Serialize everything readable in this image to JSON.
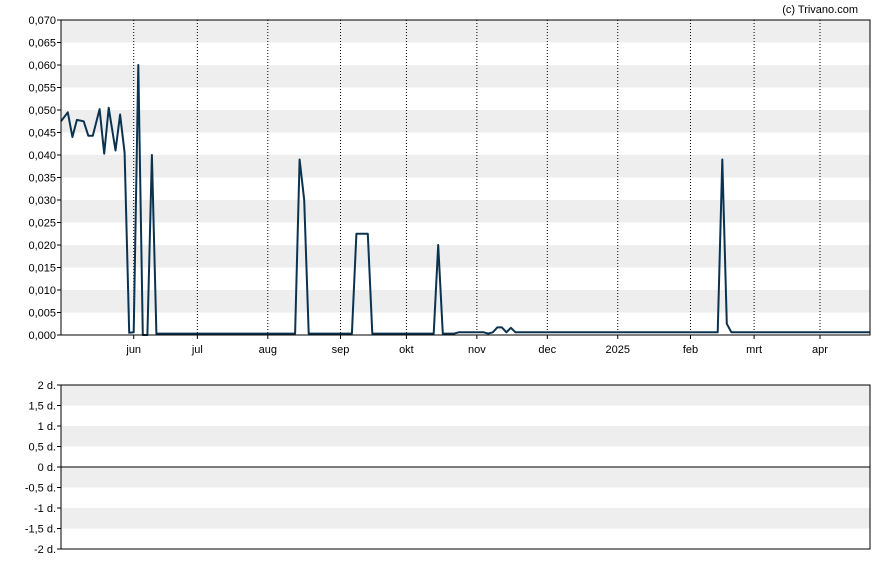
{
  "copyright": "(c) Trivano.com",
  "colors": {
    "line": "#0b3350",
    "band": "#eeeeee",
    "frame": "#000000",
    "grid": "#000000"
  },
  "chart_data": [
    {
      "type": "line",
      "title": "",
      "ylim": [
        0,
        0.07
      ],
      "grid": "alternating horizontal bands, dotted vertical month lines",
      "y_ticks": [
        "0,070",
        "0,065",
        "0,060",
        "0,055",
        "0,050",
        "0,045",
        "0,040",
        "0,035",
        "0,030",
        "0,025",
        "0,020",
        "0,015",
        "0,010",
        "0,005",
        "0,000"
      ],
      "y_tick_values": [
        0.07,
        0.065,
        0.06,
        0.055,
        0.05,
        0.045,
        0.04,
        0.035,
        0.03,
        0.025,
        0.02,
        0.015,
        0.01,
        0.005,
        0
      ],
      "x_ticks": [
        "jun",
        "jul",
        "aug",
        "sep",
        "okt",
        "nov",
        "dec",
        "2025",
        "feb",
        "mrt",
        "apr"
      ],
      "x_tick_dates": [
        "2024-06-03",
        "2024-07-01",
        "2024-08-01",
        "2024-09-02",
        "2024-10-01",
        "2024-11-01",
        "2024-12-02",
        "2025-01-02",
        "2025-02-03",
        "2025-03-03",
        "2025-04-01"
      ],
      "x_range": [
        "2024-05-02",
        "2025-04-23"
      ],
      "series": [
        {
          "name": "",
          "points": [
            [
              "2024-05-02",
              0.0475
            ],
            [
              "2024-05-05",
              0.0495
            ],
            [
              "2024-05-07",
              0.044
            ],
            [
              "2024-05-09",
              0.0478
            ],
            [
              "2024-05-12",
              0.0475
            ],
            [
              "2024-05-14",
              0.0443
            ],
            [
              "2024-05-16",
              0.0443
            ],
            [
              "2024-05-19",
              0.0502
            ],
            [
              "2024-05-21",
              0.0403
            ],
            [
              "2024-05-23",
              0.0505
            ],
            [
              "2024-05-26",
              0.041
            ],
            [
              "2024-05-28",
              0.049
            ],
            [
              "2024-05-30",
              0.0405
            ],
            [
              "2024-06-01",
              0.0005
            ],
            [
              "2024-06-03",
              0.0006
            ],
            [
              "2024-06-05",
              0.06
            ],
            [
              "2024-06-07",
              0.0
            ],
            [
              "2024-06-09",
              0.0
            ],
            [
              "2024-06-11",
              0.04
            ],
            [
              "2024-06-13",
              0.0003
            ],
            [
              "2024-08-13",
              0.0003
            ],
            [
              "2024-08-15",
              0.039
            ],
            [
              "2024-08-17",
              0.03
            ],
            [
              "2024-08-19",
              0.0003
            ],
            [
              "2024-09-07",
              0.0003
            ],
            [
              "2024-09-09",
              0.0225
            ],
            [
              "2024-09-14",
              0.0225
            ],
            [
              "2024-09-16",
              0.0003
            ],
            [
              "2024-10-13",
              0.0003
            ],
            [
              "2024-10-15",
              0.02
            ],
            [
              "2024-10-17",
              0.0003
            ],
            [
              "2024-10-22",
              0.0003
            ],
            [
              "2024-10-24",
              0.0006
            ],
            [
              "2024-11-04",
              0.0006
            ],
            [
              "2024-11-06",
              0.0003
            ],
            [
              "2024-11-08",
              0.0006
            ],
            [
              "2024-11-10",
              0.0017
            ],
            [
              "2024-11-12",
              0.0017
            ],
            [
              "2024-11-14",
              0.0006
            ],
            [
              "2024-11-16",
              0.0016
            ],
            [
              "2024-11-18",
              0.0006
            ],
            [
              "2025-02-15",
              0.0006
            ],
            [
              "2025-02-17",
              0.039
            ],
            [
              "2025-02-19",
              0.0025
            ],
            [
              "2025-02-21",
              0.0006
            ],
            [
              "2025-04-23",
              0.0006
            ]
          ]
        }
      ]
    },
    {
      "type": "line",
      "title": "",
      "ylim": [
        -2,
        2
      ],
      "y_ticks": [
        "2 d.",
        "1,5 d.",
        "1 d.",
        "0,5 d.",
        "0 d.",
        "-0,5 d.",
        "-1 d.",
        "-1,5 d.",
        "-2 d."
      ],
      "y_tick_values": [
        2,
        1.5,
        1,
        0.5,
        0,
        -0.5,
        -1,
        -1.5,
        -2
      ],
      "series": []
    }
  ]
}
